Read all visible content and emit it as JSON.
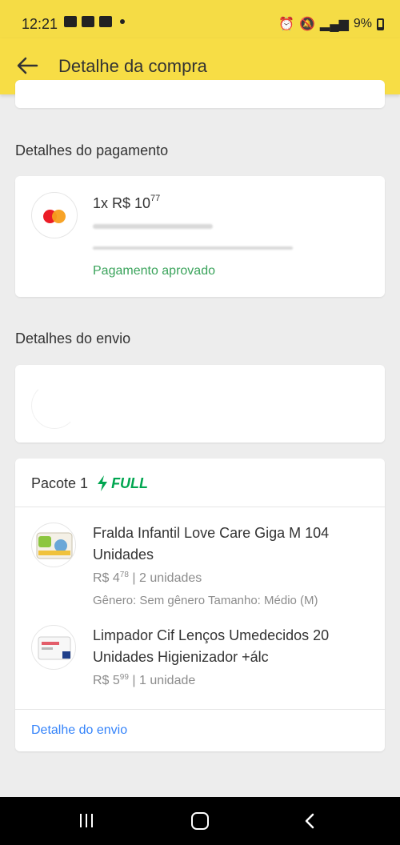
{
  "status_bar": {
    "time": "12:21",
    "battery": "9%"
  },
  "header": {
    "title": "Detalhe da compra"
  },
  "payment": {
    "section_title": "Detalhes do pagamento",
    "installments": "1x R$ 10",
    "amount_cents": "77",
    "status": "Pagamento aprovado"
  },
  "shipping": {
    "section_title": "Detalhes do envio"
  },
  "package": {
    "title": "Pacote 1",
    "badge": "FULL",
    "items": [
      {
        "name": "Fralda Infantil Love Care Giga M 104 Unidades",
        "price": "R$ 4",
        "price_cents": "78",
        "quantity": "| 2 unidades",
        "attributes": "Gênero: Sem gênero Tamanho: Médio (M)"
      },
      {
        "name": "Limpador Cif Lenços Umedecidos 20 Unidades Higienizador +álc",
        "price": "R$ 5",
        "price_cents": "99",
        "quantity": "| 1 unidade"
      }
    ],
    "link": "Detalhe do envio"
  },
  "colors": {
    "brand_yellow": "#f7dd45",
    "success_green": "#3aa35b",
    "link_blue": "#3483fa",
    "full_green": "#00a650"
  }
}
